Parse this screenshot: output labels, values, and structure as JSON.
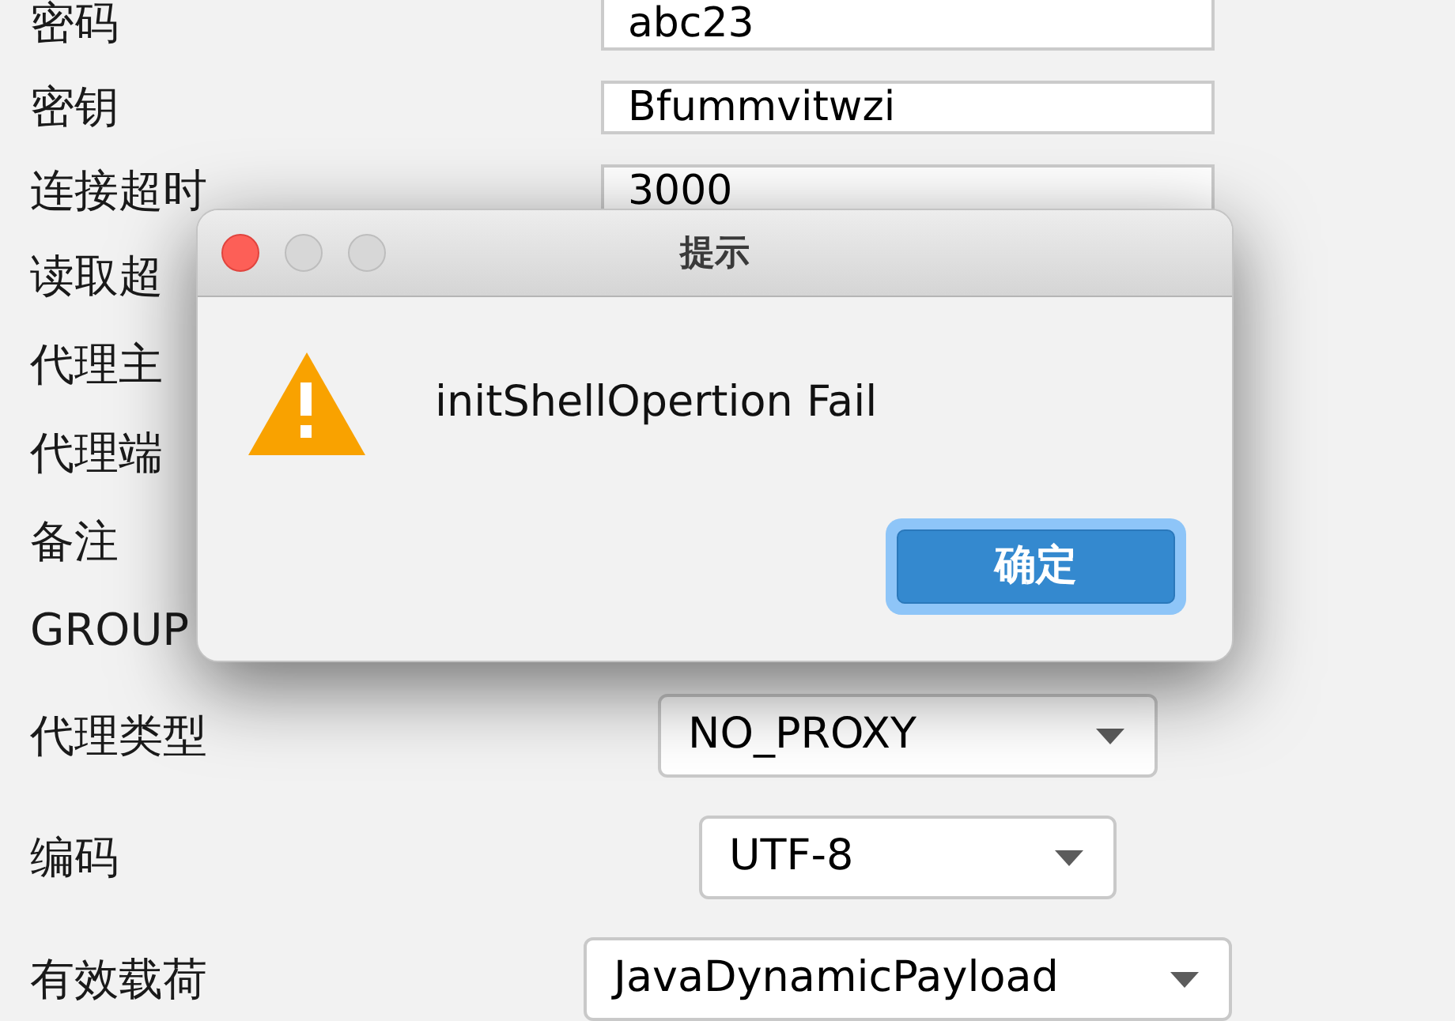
{
  "form": {
    "fields": [
      {
        "kind": "text",
        "label": "密码",
        "value": "abc23"
      },
      {
        "kind": "text",
        "label": "密钥",
        "value": "Bfummvitwzi"
      },
      {
        "kind": "text",
        "label": "连接超时",
        "value": "3000"
      },
      {
        "kind": "text",
        "label": "读取超"
      },
      {
        "kind": "text",
        "label": "代理主"
      },
      {
        "kind": "text",
        "label": "代理端"
      },
      {
        "kind": "text",
        "label": "备注"
      },
      {
        "kind": "text",
        "label": "GROUP"
      },
      {
        "kind": "select",
        "label": "代理类型",
        "value": "NO_PROXY"
      },
      {
        "kind": "select",
        "label": "编码",
        "value": "UTF-8"
      },
      {
        "kind": "select",
        "label": "有效载荷",
        "value": "JavaDynamicPayload"
      }
    ]
  },
  "dialog": {
    "title": "提示",
    "message": "initShellOpertion Fail",
    "buttons": [
      {
        "label": "确定",
        "default": true
      }
    ]
  }
}
